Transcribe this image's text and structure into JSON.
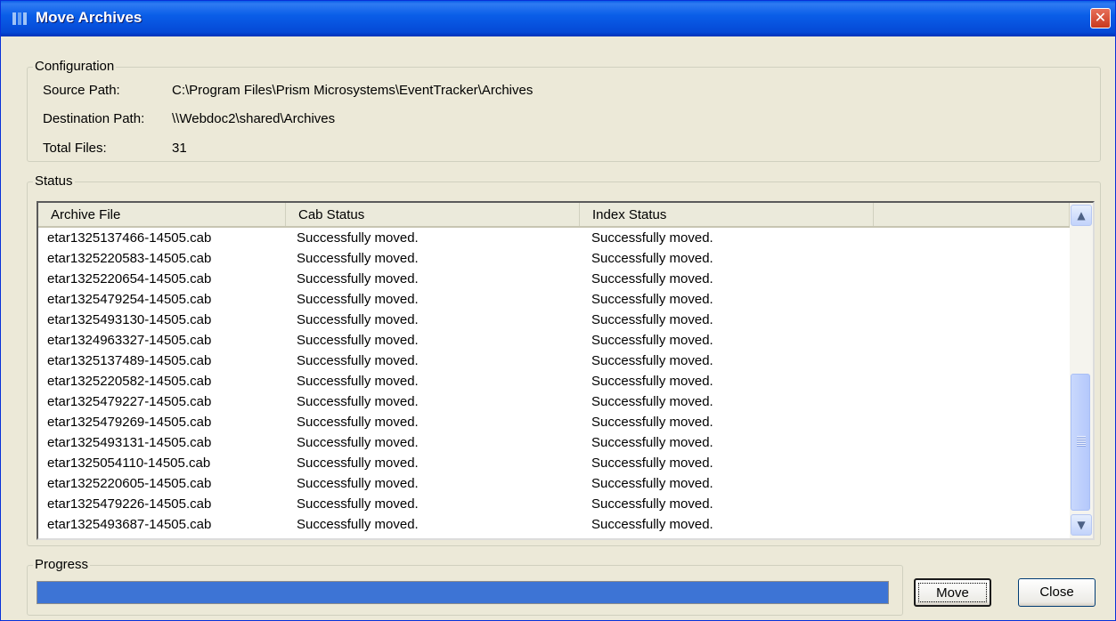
{
  "window": {
    "title": "Move Archives",
    "close_glyph": "✕"
  },
  "config": {
    "group_title": "Configuration",
    "rows": [
      {
        "label": "Source Path:",
        "value": "C:\\Program Files\\Prism Microsystems\\EventTracker\\Archives"
      },
      {
        "label": "Destination Path:",
        "value": "\\\\Webdoc2\\shared\\Archives"
      },
      {
        "label": "Total Files:",
        "value": "31"
      }
    ]
  },
  "status": {
    "group_title": "Status",
    "columns": [
      "Archive File",
      "Cab Status",
      "Index Status",
      ""
    ],
    "rows": [
      [
        "etar1325137466-14505.cab",
        "Successfully moved.",
        "Successfully moved."
      ],
      [
        "etar1325220583-14505.cab",
        "Successfully moved.",
        "Successfully moved."
      ],
      [
        "etar1325220654-14505.cab",
        "Successfully moved.",
        "Successfully moved."
      ],
      [
        "etar1325479254-14505.cab",
        "Successfully moved.",
        "Successfully moved."
      ],
      [
        "etar1325493130-14505.cab",
        "Successfully moved.",
        "Successfully moved."
      ],
      [
        "etar1324963327-14505.cab",
        "Successfully moved.",
        "Successfully moved."
      ],
      [
        "etar1325137489-14505.cab",
        "Successfully moved.",
        "Successfully moved."
      ],
      [
        "etar1325220582-14505.cab",
        "Successfully moved.",
        "Successfully moved."
      ],
      [
        "etar1325479227-14505.cab",
        "Successfully moved.",
        "Successfully moved."
      ],
      [
        "etar1325479269-14505.cab",
        "Successfully moved.",
        "Successfully moved."
      ],
      [
        "etar1325493131-14505.cab",
        "Successfully moved.",
        "Successfully moved."
      ],
      [
        "etar1325054110-14505.cab",
        "Successfully moved.",
        "Successfully moved."
      ],
      [
        "etar1325220605-14505.cab",
        "Successfully moved.",
        "Successfully moved."
      ],
      [
        "etar1325479226-14505.cab",
        "Successfully moved.",
        "Successfully moved."
      ],
      [
        "etar1325493687-14505.cab",
        "Successfully moved.",
        "Successfully moved."
      ]
    ],
    "scroll_up_glyph": "▲",
    "scroll_down_glyph": "▼"
  },
  "progress": {
    "group_title": "Progress",
    "fraction": 1.0
  },
  "buttons": {
    "move_label": "Move",
    "close_label": "Close"
  },
  "colors": {
    "titlebar": "#0a5ee8",
    "progress_fill": "#3d74d5",
    "close_button": "#d9442a"
  }
}
